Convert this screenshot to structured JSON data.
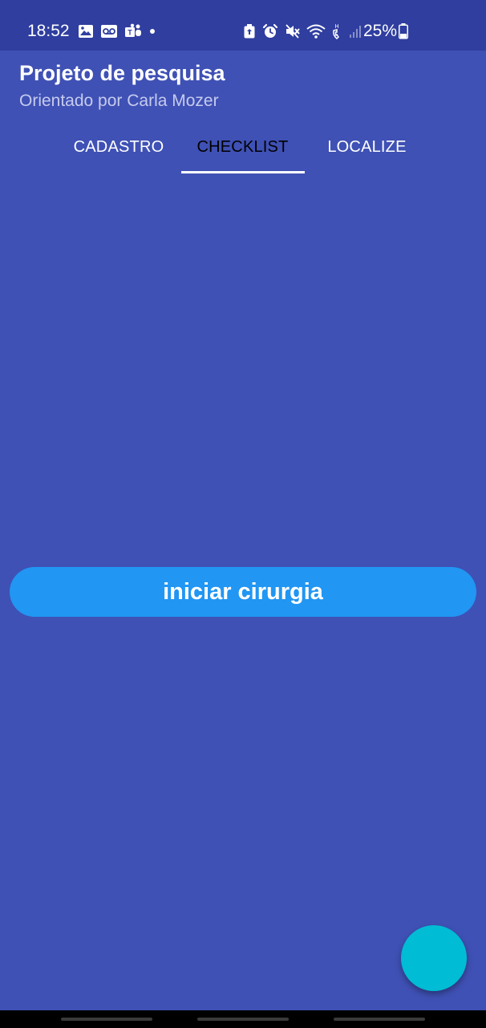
{
  "status_bar": {
    "time": "18:52",
    "battery_percent": "25%",
    "left_icons": [
      "image-icon",
      "voicemail-icon",
      "teams-icon",
      "dot-icon"
    ],
    "right_icons": [
      "battery-saver-icon",
      "alarm-icon",
      "mute-icon",
      "wifi-icon",
      "hd-call-icon",
      "signal-icon",
      "battery-icon"
    ]
  },
  "header": {
    "title": "Projeto de pesquisa",
    "subtitle": "Orientado por Carla Mozer"
  },
  "tabs": [
    {
      "label": "CADASTRO",
      "selected": false
    },
    {
      "label": "CHECKLIST",
      "selected": true
    },
    {
      "label": "LOCALIZE",
      "selected": false
    }
  ],
  "main": {
    "start_button_label": "iniciar cirurgia"
  },
  "colors": {
    "background": "#3f51b5",
    "status_bar": "#2f3e9f",
    "button": "#2196f3",
    "fab": "#00bcd4"
  }
}
